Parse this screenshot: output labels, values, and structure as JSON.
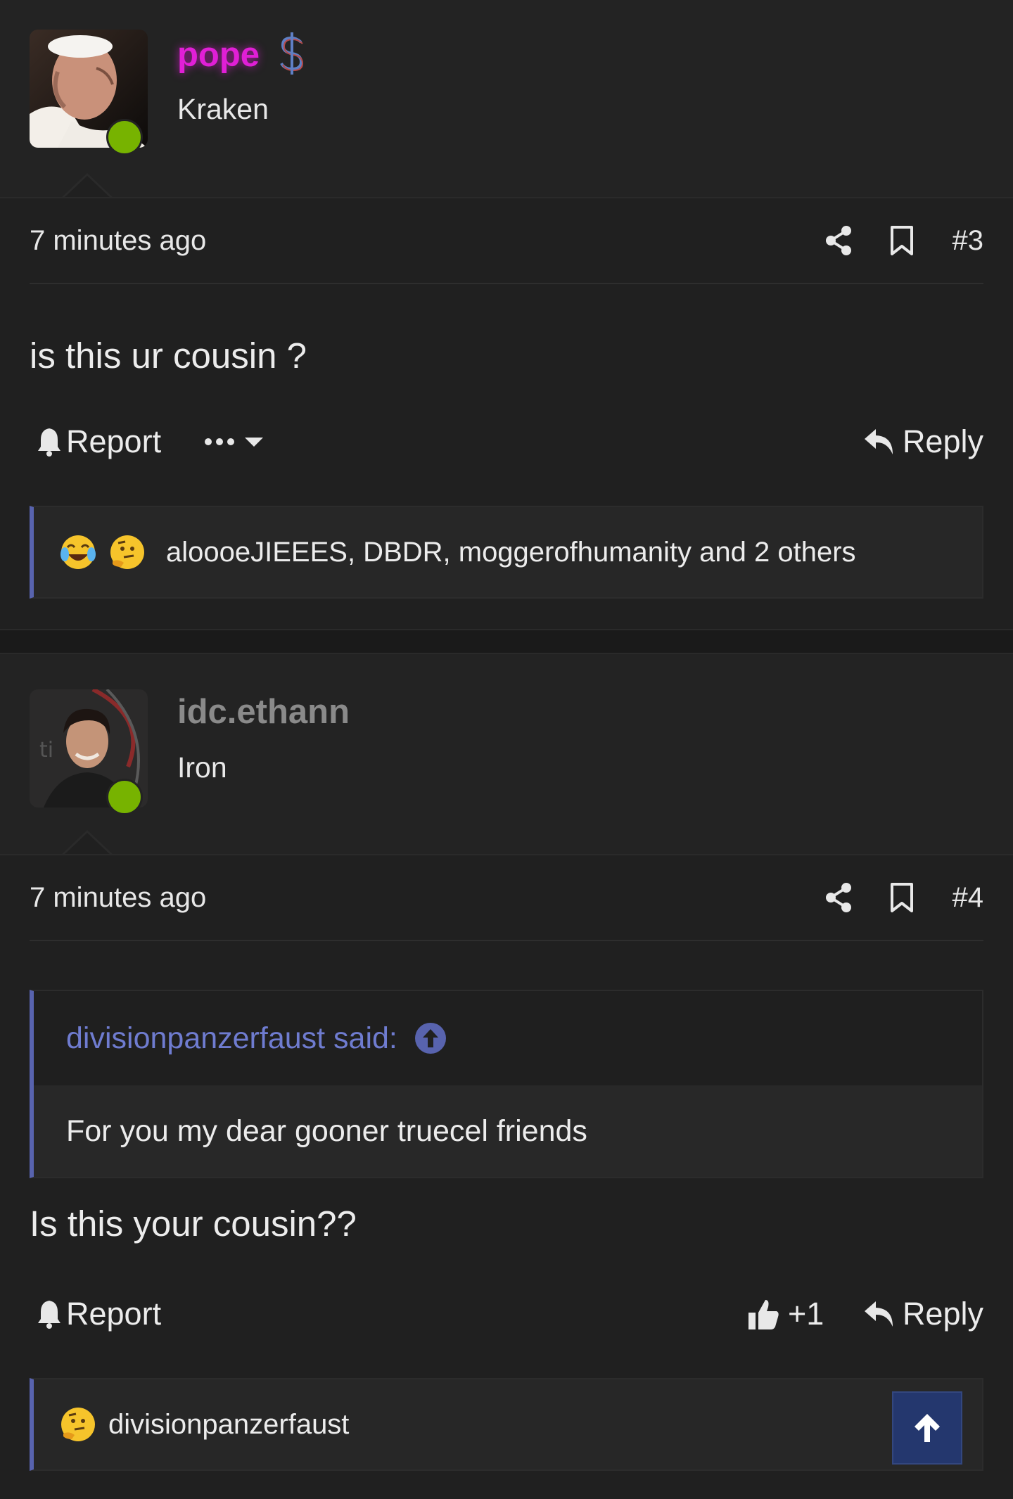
{
  "posts": [
    {
      "username": "pope",
      "username_color": "#e01fd6",
      "badge_icon": "dollar-sign-icon",
      "user_title": "Kraken",
      "time": "7 minutes ago",
      "post_number": "#3",
      "body": "is this ur cousin ?",
      "report_label": "Report",
      "reply_label": "Reply",
      "reactions_text": "aloooeJIEEES, DBDR, moggerofhumanity and 2 others",
      "reaction_emojis": [
        "crying-laughing-emoji",
        "thinking-emoji"
      ]
    },
    {
      "username": "idc.ethann",
      "username_color": "#8a8a8a",
      "user_title": "Iron",
      "time": "7 minutes ago",
      "post_number": "#4",
      "quote": {
        "author_line": "divisionpanzerfaust said:",
        "text": "For you my dear gooner truecel friends"
      },
      "body": "Is this your cousin??",
      "report_label": "Report",
      "like_count": "+1",
      "reply_label": "Reply",
      "reactions_text": "divisionpanzerfaust",
      "reaction_emojis": [
        "thinking-emoji"
      ]
    }
  ],
  "colors": {
    "accent": "#5863ae",
    "online": "#77b300",
    "scroll_button": "#24376e"
  }
}
